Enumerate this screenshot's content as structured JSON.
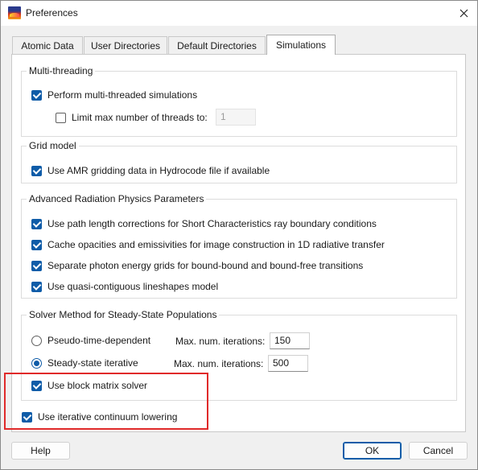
{
  "window": {
    "title": "Preferences",
    "close_icon": "close-icon",
    "app_icon": "app-logo-icon"
  },
  "tabs": [
    {
      "label": "Atomic Data",
      "active": false
    },
    {
      "label": "User Directories",
      "active": false
    },
    {
      "label": "Default Directories",
      "active": false
    },
    {
      "label": "Simulations",
      "active": true
    }
  ],
  "multithreading": {
    "title": "Multi-threading",
    "perform": {
      "label": "Perform multi-threaded simulations",
      "checked": true
    },
    "limit": {
      "label": "Limit max number of threads to:",
      "checked": false
    },
    "max_threads_value": "1"
  },
  "grid_model": {
    "title": "Grid model",
    "amr": {
      "label": "Use AMR gridding data in Hydrocode file if available",
      "checked": true
    }
  },
  "radiation": {
    "title": "Advanced Radiation Physics Parameters",
    "options": [
      {
        "label": "Use path length corrections for Short Characteristics ray boundary conditions",
        "checked": true
      },
      {
        "label": "Cache opacities and emissivities for image construction in 1D radiative transfer",
        "checked": true
      },
      {
        "label": "Separate photon energy grids for bound-bound and bound-free transitions",
        "checked": true
      },
      {
        "label": "Use quasi-contiguous lineshapes model",
        "checked": true
      }
    ]
  },
  "solver": {
    "title": "Solver Method for Steady-State Populations",
    "pseudo_time": {
      "label": "Pseudo-time-dependent",
      "selected": false
    },
    "pseudo_iter_label": "Max. num. iterations:",
    "pseudo_iter_value": "150",
    "steady_state": {
      "label": "Steady-state iterative",
      "selected": true
    },
    "steady_iter_label": "Max. num. iterations:",
    "steady_iter_value": "500",
    "block_matrix": {
      "label": "Use block matrix solver",
      "checked": true
    }
  },
  "continuum_lowering": {
    "label": "Use iterative continuum lowering",
    "checked": true
  },
  "buttons": {
    "help": "Help",
    "ok": "OK",
    "cancel": "Cancel"
  },
  "colors": {
    "accent": "#0f5ca8",
    "highlight": "#e02a2a"
  }
}
